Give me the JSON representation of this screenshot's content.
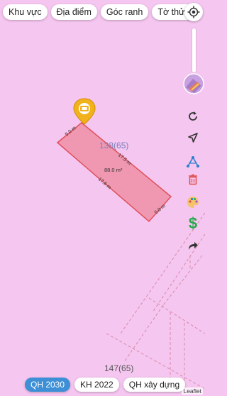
{
  "filters": [
    {
      "label": "Khu vực"
    },
    {
      "label": "Địa điểm"
    },
    {
      "label": "Góc ranh"
    },
    {
      "label": "Tờ thửa"
    }
  ],
  "map": {
    "parcel_labels": [
      "138(65)",
      "147(65)"
    ],
    "plot": {
      "area": "88.0 m²",
      "edges": [
        "5.0 m",
        "17.5 m",
        "17.6 m",
        "5.0 m"
      ]
    },
    "colors": {
      "background": "#f5c6f0",
      "plot_fill": "#ef8fa6",
      "plot_stroke": "#e0505c",
      "boundary": "#d98aa8"
    }
  },
  "controls": {
    "icons": [
      "locate-icon",
      "layer-thumbnail",
      "refresh-icon",
      "navigate-icon",
      "measure-icon",
      "delete-icon",
      "palette-icon",
      "dollar-icon",
      "share-icon"
    ]
  },
  "tabs": [
    {
      "label": "QH 2030",
      "active": true
    },
    {
      "label": "KH 2022",
      "active": false
    },
    {
      "label": "QH xây dựng",
      "active": false
    }
  ],
  "attribution": "Leaflet"
}
